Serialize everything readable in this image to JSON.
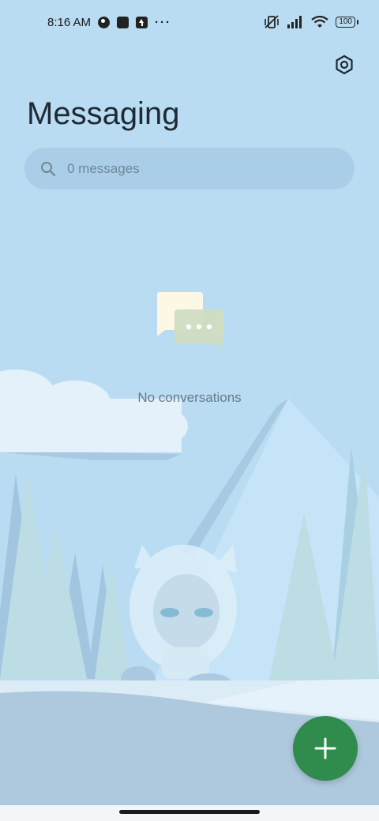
{
  "status_bar": {
    "time": "8:16 AM",
    "battery": "100",
    "icons": [
      "notification-circle-icon",
      "notification-square-icon",
      "upload-arrow-icon",
      "more-dots-icon",
      "vibrate-off-icon",
      "signal-icon",
      "wifi-icon",
      "battery-icon"
    ]
  },
  "header": {
    "title": "Messaging",
    "settings_icon": "settings-hexagon-icon"
  },
  "search": {
    "placeholder": "0 messages",
    "icon": "search-icon"
  },
  "empty_state": {
    "icon": "chat-bubbles-icon",
    "text": "No conversations"
  },
  "fab": {
    "icon": "plus-icon",
    "color": "#2f8c4c"
  },
  "colors": {
    "background": "#b9dcf3",
    "accent": "#2f8c4c"
  }
}
